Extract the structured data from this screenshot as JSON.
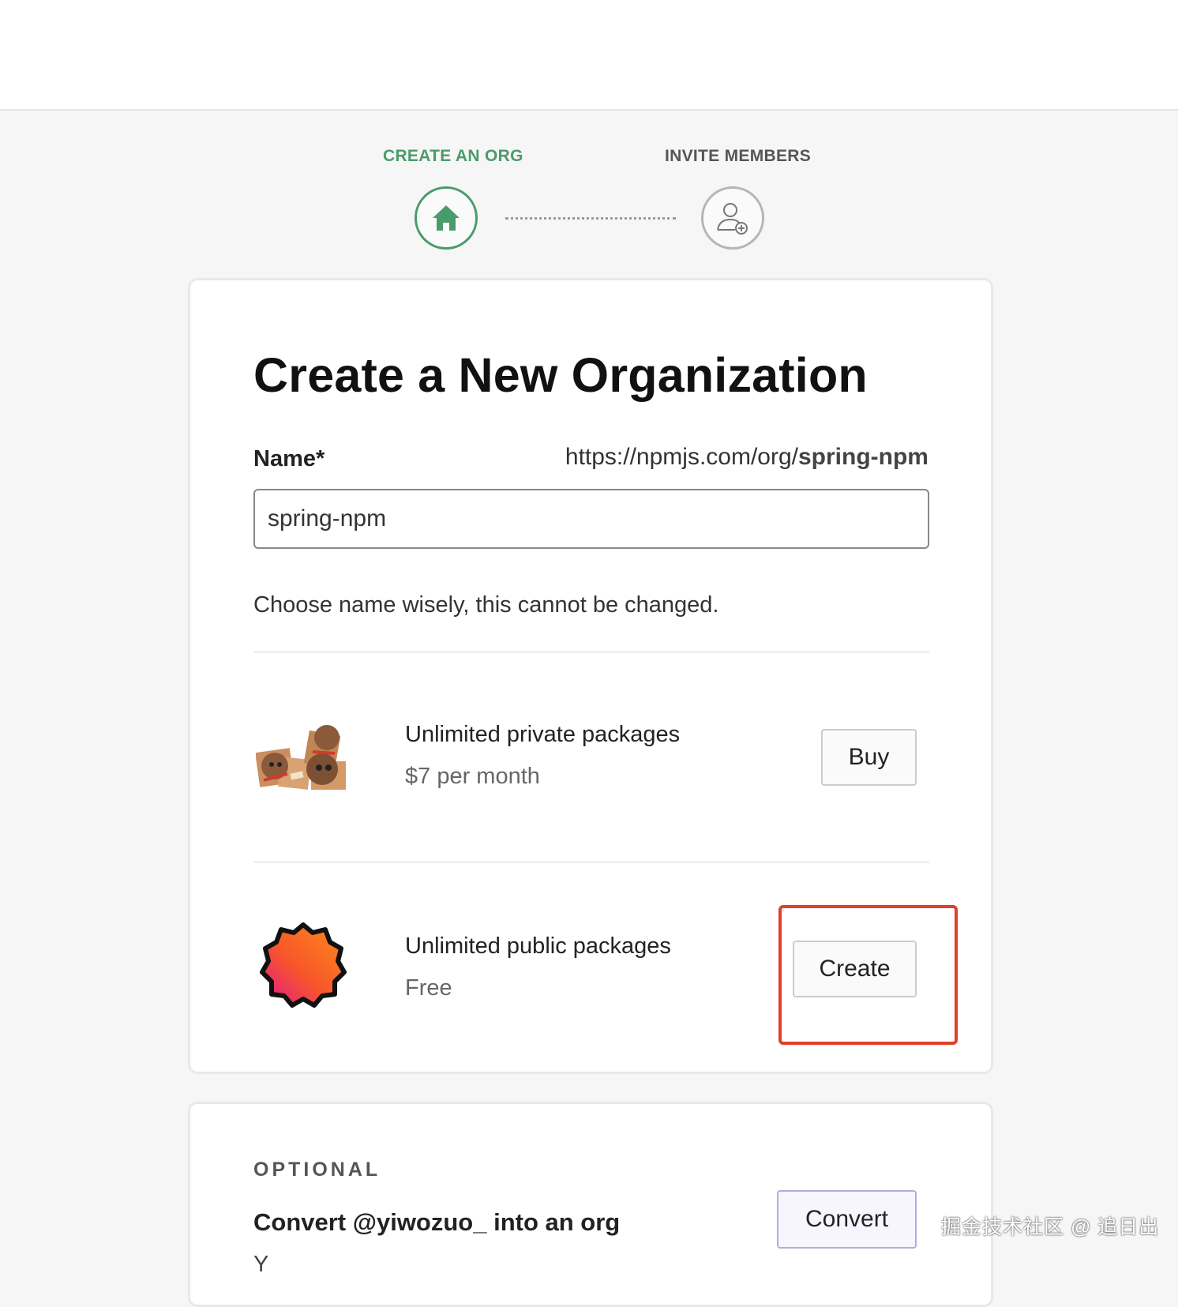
{
  "stepper": {
    "step1": "CREATE AN ORG",
    "step2": "INVITE MEMBERS",
    "step1_icon": "home-icon",
    "step2_icon": "add-user-icon",
    "active_color": "#4a9b6b"
  },
  "form": {
    "title": "Create a New Organization",
    "name_label": "Name*",
    "url_prefix": "https://npmjs.com/org/",
    "url_name": "spring-npm",
    "name_value": "spring-npm",
    "hint": "Choose name wisely, this cannot be changed."
  },
  "plans": [
    {
      "title": "Unlimited private packages",
      "price": "$7 per month",
      "button": "Buy",
      "icon": "boxes-illustration"
    },
    {
      "title": "Unlimited public packages",
      "price": "Free",
      "button": "Create",
      "icon": "orange-badge-icon",
      "highlight_color": "#e0402a"
    }
  ],
  "optional": {
    "label": "OPTIONAL",
    "title": "Convert @yiwozuo_ into an org",
    "button": "Convert",
    "text": "Y"
  },
  "watermark": "掘金技术社区 @ 追日出"
}
